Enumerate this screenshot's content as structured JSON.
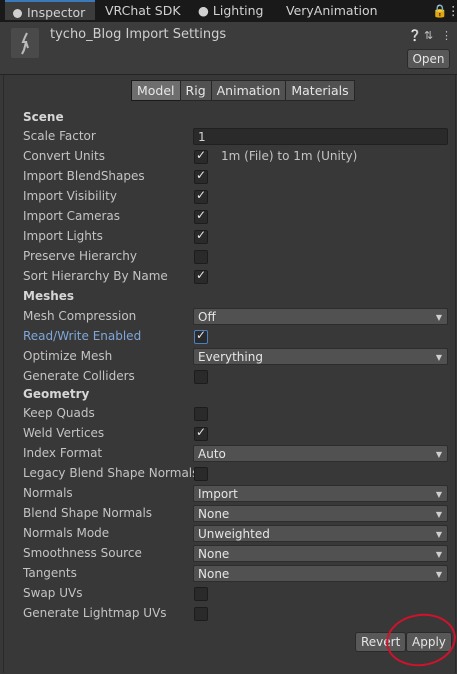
{
  "tabs": [
    "Inspector",
    "VRChat SDK",
    "Lighting",
    "VeryAnimation"
  ],
  "header": {
    "title": "tycho_Blog Import Settings",
    "open_label": "Open"
  },
  "subtabs": [
    "Model",
    "Rig",
    "Animation",
    "Materials"
  ],
  "scene": {
    "section": "Scene",
    "scale_factor_label": "Scale Factor",
    "scale_factor_value": "1",
    "convert_units_label": "Convert Units",
    "convert_units_text": "1m (File) to 1m (Unity)",
    "import_blendshapes": "Import BlendShapes",
    "import_visibility": "Import Visibility",
    "import_cameras": "Import Cameras",
    "import_lights": "Import Lights",
    "preserve_hierarchy": "Preserve Hierarchy",
    "sort_hierarchy": "Sort Hierarchy By Name"
  },
  "meshes": {
    "section": "Meshes",
    "mesh_compression_label": "Mesh Compression",
    "mesh_compression_value": "Off",
    "read_write_label": "Read/Write Enabled",
    "optimize_mesh_label": "Optimize Mesh",
    "optimize_mesh_value": "Everything",
    "generate_colliders": "Generate Colliders"
  },
  "geometry": {
    "section": "Geometry",
    "keep_quads": "Keep Quads",
    "weld_vertices": "Weld Vertices",
    "index_format_label": "Index Format",
    "index_format_value": "Auto",
    "legacy_blend": "Legacy Blend Shape Normals",
    "normals_label": "Normals",
    "normals_value": "Import",
    "blend_shape_normals_label": "Blend Shape Normals",
    "blend_shape_normals_value": "None",
    "normals_mode_label": "Normals Mode",
    "normals_mode_value": "Unweighted",
    "smoothness_label": "Smoothness Source",
    "smoothness_value": "None",
    "tangents_label": "Tangents",
    "tangents_value": "None",
    "swap_uvs": "Swap UVs",
    "gen_lightmap_uvs": "Generate Lightmap UVs"
  },
  "footer": {
    "revert_label": "Revert",
    "apply_label": "Apply"
  },
  "colors": {
    "annotation": "#d0122b",
    "accent": "#3a79bb"
  }
}
